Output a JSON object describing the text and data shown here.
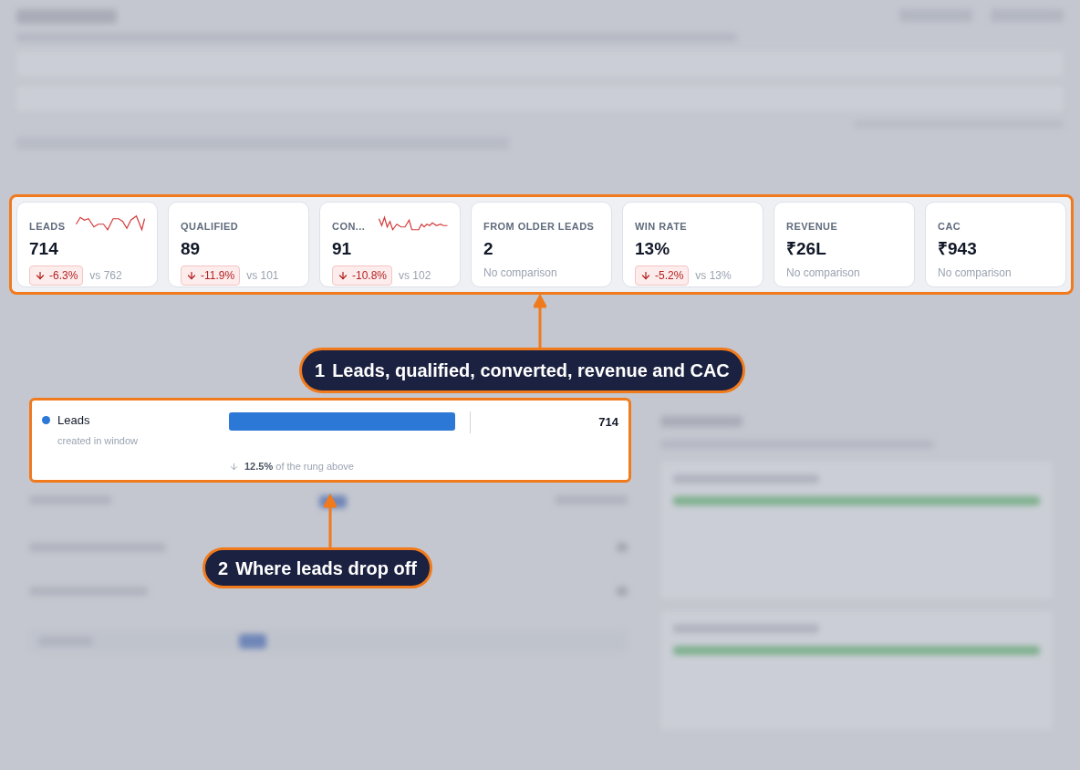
{
  "kpis": [
    {
      "label": "LEADS",
      "value": "714",
      "sparkline": true,
      "negative": true,
      "delta": "-6.3%",
      "compare": "vs 762"
    },
    {
      "label": "QUALIFIED",
      "value": "89",
      "sparkline": false,
      "negative": true,
      "delta": "-11.9%",
      "compare": "vs 101"
    },
    {
      "label": "CON...",
      "value": "91",
      "sparkline": true,
      "negative": true,
      "delta": "-10.8%",
      "compare": "vs 102"
    },
    {
      "label": "FROM OLDER LEADS",
      "value": "2",
      "sparkline": false,
      "note": "No comparison"
    },
    {
      "label": "WIN RATE",
      "value": "13%",
      "sparkline": false,
      "negative": true,
      "delta": "-5.2%",
      "compare": "vs 13%"
    },
    {
      "label": "REVENUE",
      "value": "₹26L",
      "sparkline": false,
      "note": "No comparison"
    },
    {
      "label": "CAC",
      "value": "₹943",
      "sparkline": false,
      "note": "No comparison"
    }
  ],
  "funnel_row": {
    "label": "Leads",
    "sublabel": "created in window",
    "color": "#2b78d6",
    "value": "714",
    "drop": "**12.5%** of the rung above"
  },
  "callouts": [
    {
      "number": "1",
      "text": "Leads, qualified, converted, revenue and CAC"
    },
    {
      "number": "2",
      "text": "Where leads drop off"
    }
  ]
}
